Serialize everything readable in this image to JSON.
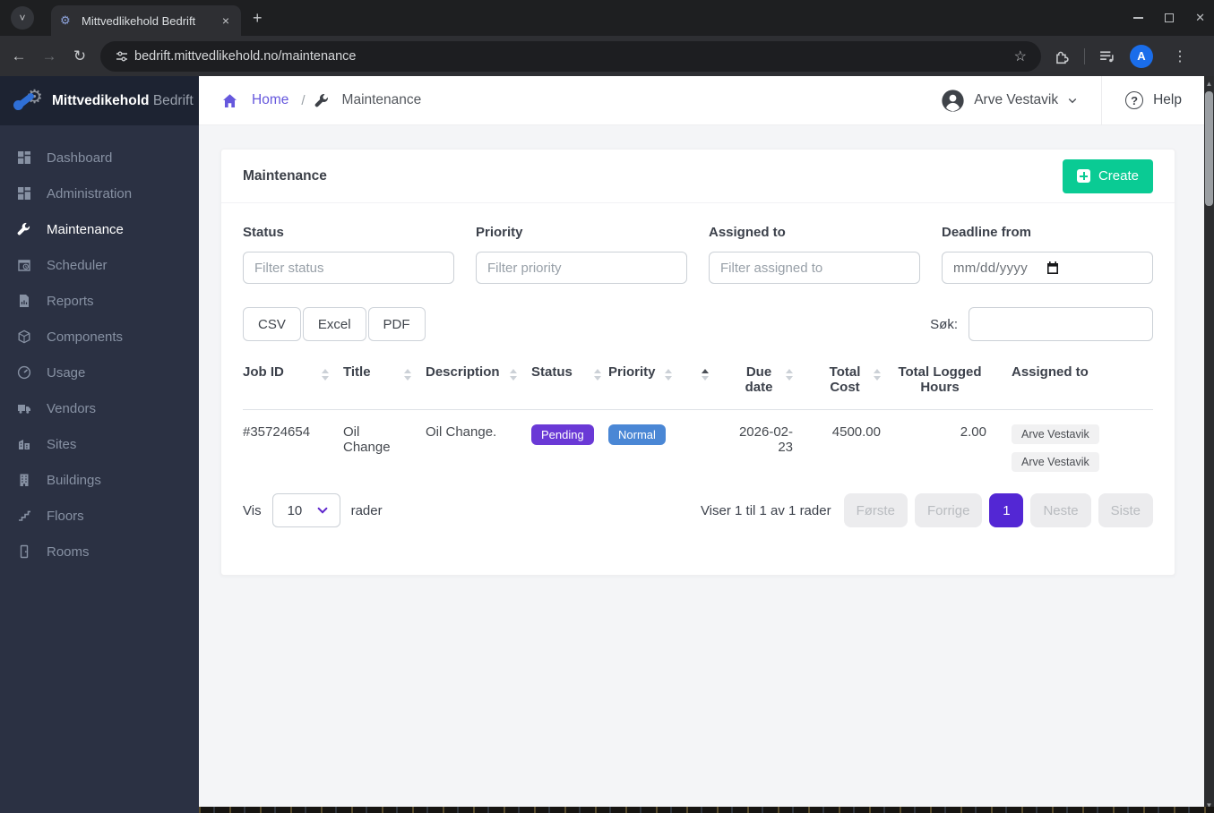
{
  "browser": {
    "tab_title": "Mittvedlikehold Bedrift",
    "url": "bedrift.mittvedlikehold.no/maintenance",
    "profile_initial": "A"
  },
  "icons": {
    "tab_chevron": "˅",
    "tab_close": "×",
    "new_tab": "+",
    "back": "←",
    "forward": "→",
    "reload": "↻",
    "star": "☆",
    "kebab": "⋮",
    "favicon_gear": "⚙",
    "brand_gear": "⚙",
    "question_mark": "?",
    "window_close": "✕"
  },
  "sidebar": {
    "brand_bold": "Mittvedikehold",
    "brand_light": "Bedrift",
    "items": [
      {
        "label": "Dashboard"
      },
      {
        "label": "Administration"
      },
      {
        "label": "Maintenance"
      },
      {
        "label": "Scheduler"
      },
      {
        "label": "Reports"
      },
      {
        "label": "Components"
      },
      {
        "label": "Usage"
      },
      {
        "label": "Vendors"
      },
      {
        "label": "Sites"
      },
      {
        "label": "Buildings"
      },
      {
        "label": "Floors"
      },
      {
        "label": "Rooms"
      }
    ]
  },
  "topbar": {
    "breadcrumb_home": "Home",
    "breadcrumb_separator": "/",
    "breadcrumb_current": "Maintenance",
    "user_name": "Arve Vestavik",
    "help_label": "Help"
  },
  "page": {
    "card_title": "Maintenance",
    "create_button": "Create",
    "filters": [
      {
        "label": "Status",
        "placeholder": "Filter status"
      },
      {
        "label": "Priority",
        "placeholder": "Filter priority"
      },
      {
        "label": "Assigned to",
        "placeholder": "Filter assigned to"
      },
      {
        "label": "Deadline from",
        "placeholder": "mm/dd/yyyy"
      }
    ],
    "export_buttons": [
      "CSV",
      "Excel",
      "PDF"
    ],
    "search_label": "Søk:",
    "table": {
      "headers": [
        "Job ID",
        "Title",
        "Description",
        "Status",
        "Priority",
        "Due date",
        "Total Cost",
        "Total Logged Hours",
        "Assigned to"
      ],
      "row": {
        "job_id": "#35724654",
        "title": "Oil Change",
        "description": "Oil Change.",
        "status": "Pending",
        "priority": "Normal",
        "due_date": "2026-02-23",
        "total_cost": "4500.00",
        "total_logged_hours": "2.00",
        "assigned_to": [
          "Arve Vestavik",
          "Arve Vestavik"
        ]
      }
    },
    "footer": {
      "show_prefix": "Vis",
      "page_size": "10",
      "show_suffix": "rader",
      "info": "Viser 1 til 1 av 1 rader",
      "first": "Første",
      "previous": "Forrige",
      "page": "1",
      "next": "Neste",
      "last": "Siste"
    }
  },
  "colors": {
    "accent_purple": "#6658dd",
    "pagination_active": "#5327d4",
    "badge_pending": "#6a39d6",
    "badge_normal": "#4a87d5",
    "create_green": "#0acb94",
    "sidebar_bg": "#2b3143"
  }
}
